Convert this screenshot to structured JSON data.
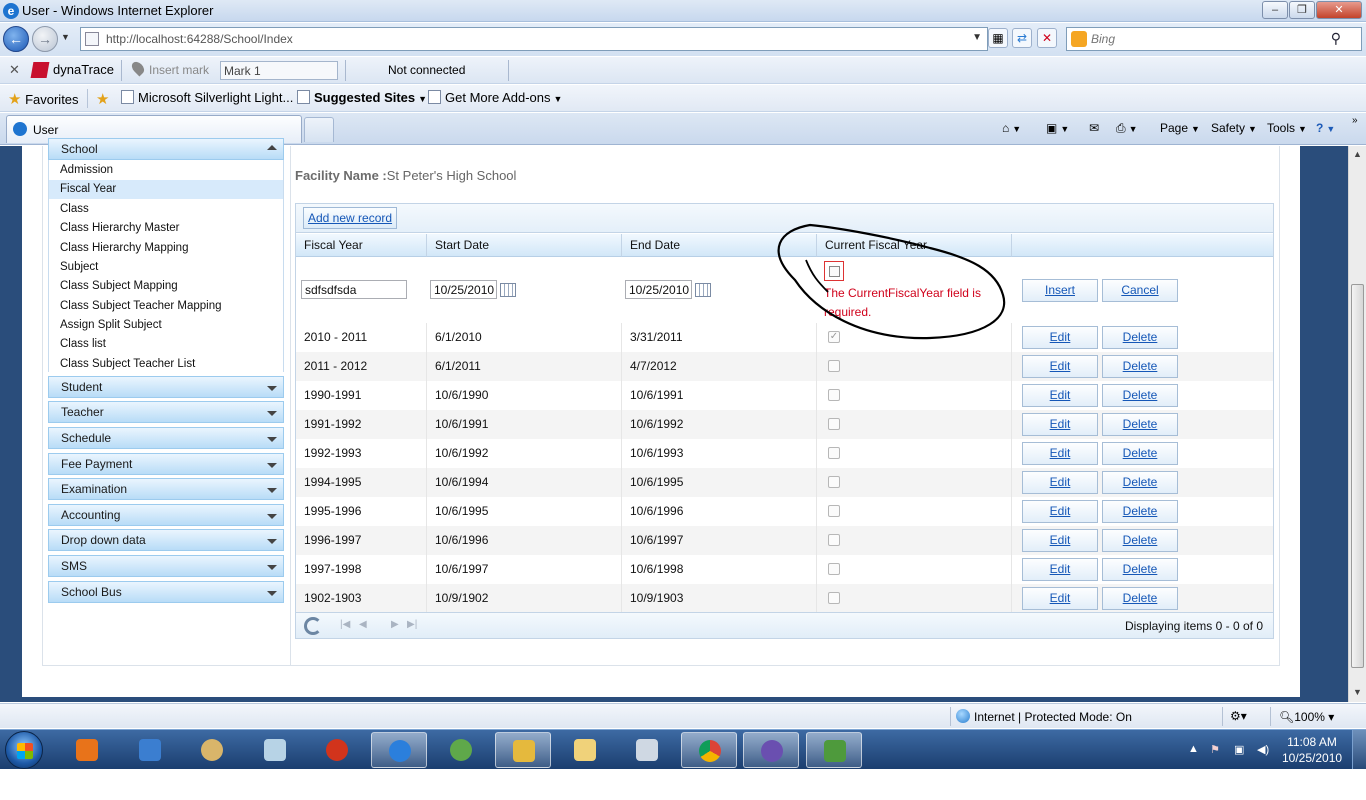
{
  "window": {
    "title": "User - Windows Internet Explorer"
  },
  "address_bar": {
    "url": "http://localhost:64288/School/Index",
    "search_placeholder": "Bing"
  },
  "dynatrace": {
    "label": "dynaTrace",
    "insert_mark": "Insert mark",
    "mark_value": "Mark 1",
    "status": "Not connected"
  },
  "favorites": {
    "label": "Favorites",
    "items": [
      "Microsoft Silverlight Light...",
      "Suggested Sites",
      "Get More Add-ons"
    ]
  },
  "tab": {
    "title": "User"
  },
  "commands": {
    "page": "Page",
    "safety": "Safety",
    "tools": "Tools"
  },
  "sidebar": {
    "sections": [
      {
        "label": "School",
        "expanded": true
      },
      {
        "label": "Student"
      },
      {
        "label": "Teacher"
      },
      {
        "label": "Schedule"
      },
      {
        "label": "Fee Payment"
      },
      {
        "label": "Examination"
      },
      {
        "label": "Accounting"
      },
      {
        "label": "Drop down data"
      },
      {
        "label": "SMS"
      },
      {
        "label": "School Bus"
      }
    ],
    "school_items": [
      "Admission",
      "Fiscal Year",
      "Class",
      "Class Hierarchy Master",
      "Class Hierarchy Mapping",
      "Subject",
      "Class Subject Mapping",
      "Class Subject Teacher Mapping",
      "Assign Split Subject",
      "Class list",
      "Class Subject Teacher List"
    ],
    "selected_item": "Fiscal Year"
  },
  "facility": {
    "label": "Facility Name :",
    "value": "St Peter's High School"
  },
  "grid": {
    "add_label": "Add new record",
    "columns": [
      "Fiscal Year",
      "Start Date",
      "End Date",
      "Current Fiscal Year",
      ""
    ],
    "edit_row": {
      "fiscal_year": "sdfsdfsda",
      "start_date": "10/25/2010",
      "end_date": "10/25/2010",
      "error": "The CurrentFiscalYear field is required.",
      "insert_label": "Insert",
      "cancel_label": "Cancel"
    },
    "rows": [
      {
        "fiscal_year": "2010 - 2011",
        "start": "6/1/2010",
        "end": "3/31/2011",
        "current": true
      },
      {
        "fiscal_year": "2011 - 2012",
        "start": "6/1/2011",
        "end": "4/7/2012",
        "current": false
      },
      {
        "fiscal_year": "1990-1991",
        "start": "10/6/1990",
        "end": "10/6/1991",
        "current": false
      },
      {
        "fiscal_year": "1991-1992",
        "start": "10/6/1991",
        "end": "10/6/1992",
        "current": false
      },
      {
        "fiscal_year": "1992-1993",
        "start": "10/6/1992",
        "end": "10/6/1993",
        "current": false
      },
      {
        "fiscal_year": "1994-1995",
        "start": "10/6/1994",
        "end": "10/6/1995",
        "current": false
      },
      {
        "fiscal_year": "1995-1996",
        "start": "10/6/1995",
        "end": "10/6/1996",
        "current": false
      },
      {
        "fiscal_year": "1996-1997",
        "start": "10/6/1996",
        "end": "10/6/1997",
        "current": false
      },
      {
        "fiscal_year": "1997-1998",
        "start": "10/6/1997",
        "end": "10/6/1998",
        "current": false
      },
      {
        "fiscal_year": "1902-1903",
        "start": "10/9/1902",
        "end": "10/9/1903",
        "current": false
      }
    ],
    "edit_label": "Edit",
    "delete_label": "Delete",
    "pager_info": "Displaying items 0 - 0 of 0"
  },
  "status_bar": {
    "zone": "Internet | Protected Mode: On",
    "zoom": "100%"
  },
  "taskbar": {
    "time": "11:08 AM",
    "date": "10/25/2010"
  },
  "colors": {
    "accent": "#1557b7",
    "error": "#d0021b",
    "header_gradient": "#b8dcf7",
    "page_background": "#2a4d7b"
  }
}
